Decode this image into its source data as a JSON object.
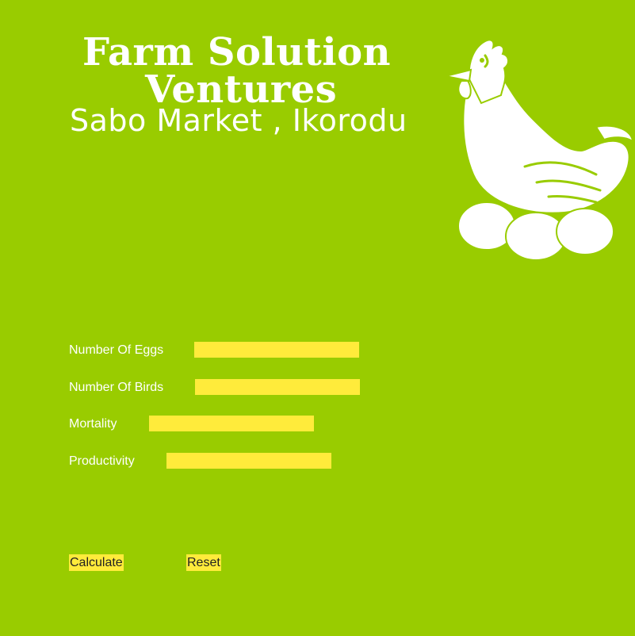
{
  "header": {
    "title_line1": "Farm Solution",
    "title_line2": "Ventures",
    "subtitle": "Sabo Market , Ikorodu"
  },
  "logo": {
    "icon": "hen-with-eggs-icon",
    "color": "#ffffff"
  },
  "form": {
    "fields": [
      {
        "label": "Number Of Eggs",
        "value": ""
      },
      {
        "label": "Number Of Birds",
        "value": ""
      },
      {
        "label": "Mortality",
        "value": ""
      },
      {
        "label": "Productivity",
        "value": ""
      }
    ]
  },
  "buttons": {
    "calculate_label": "Calculate",
    "reset_label": "Reset"
  },
  "colors": {
    "background": "#99cc00",
    "input_fill": "#ffeb3b",
    "text": "#ffffff"
  }
}
